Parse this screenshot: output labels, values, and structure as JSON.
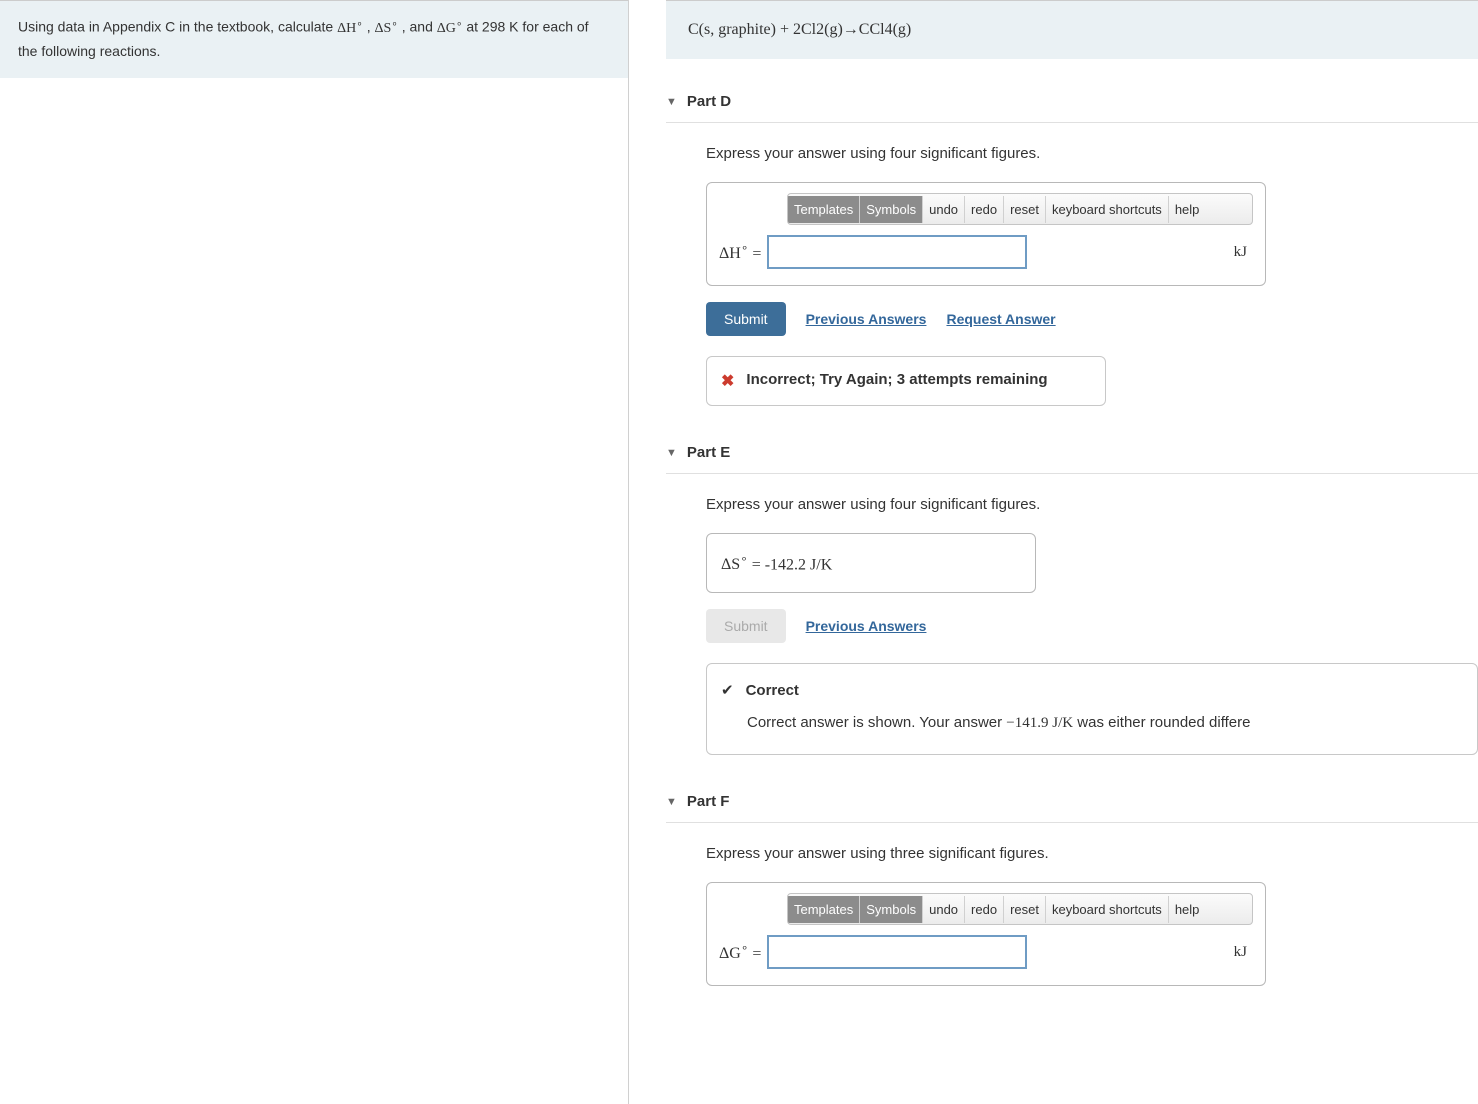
{
  "question": {
    "prefix": "Using data in Appendix C in the textbook, calculate ",
    "dh": "ΔH",
    "ds": "ΔS",
    "dg": "ΔG",
    "sep1": " , ",
    "sep2": " , and ",
    "suffix": " at 298 K for each of the following reactions."
  },
  "reaction": "C(s, graphite) + 2Cl2(g)→CCl4(g)",
  "toolbar": {
    "templates": "Templates",
    "symbols": "Symbols",
    "undo": "undo",
    "redo": "redo",
    "reset": "reset",
    "shortcuts": "keyboard shortcuts",
    "help": "help"
  },
  "partD": {
    "title": "Part D",
    "instructions": "Express your answer using four significant figures.",
    "label": "ΔH",
    "eq": " =",
    "unit": "kJ",
    "submit": "Submit",
    "prev": "Previous Answers",
    "req": "Request Answer",
    "feedback": "Incorrect; Try Again; 3 attempts remaining"
  },
  "partE": {
    "title": "Part E",
    "instructions": "Express your answer using four significant figures.",
    "label": "ΔS",
    "value": " = -142.2 J/K",
    "submit": "Submit",
    "prev": "Previous Answers",
    "correct": "Correct",
    "msg1": "Correct answer is shown. Your answer ",
    "ans": "−141.9 J/K",
    "msg2": " was either rounded differe"
  },
  "partF": {
    "title": "Part F",
    "instructions": "Express your answer using three significant figures.",
    "label": "ΔG",
    "eq": " =",
    "unit": "kJ"
  }
}
